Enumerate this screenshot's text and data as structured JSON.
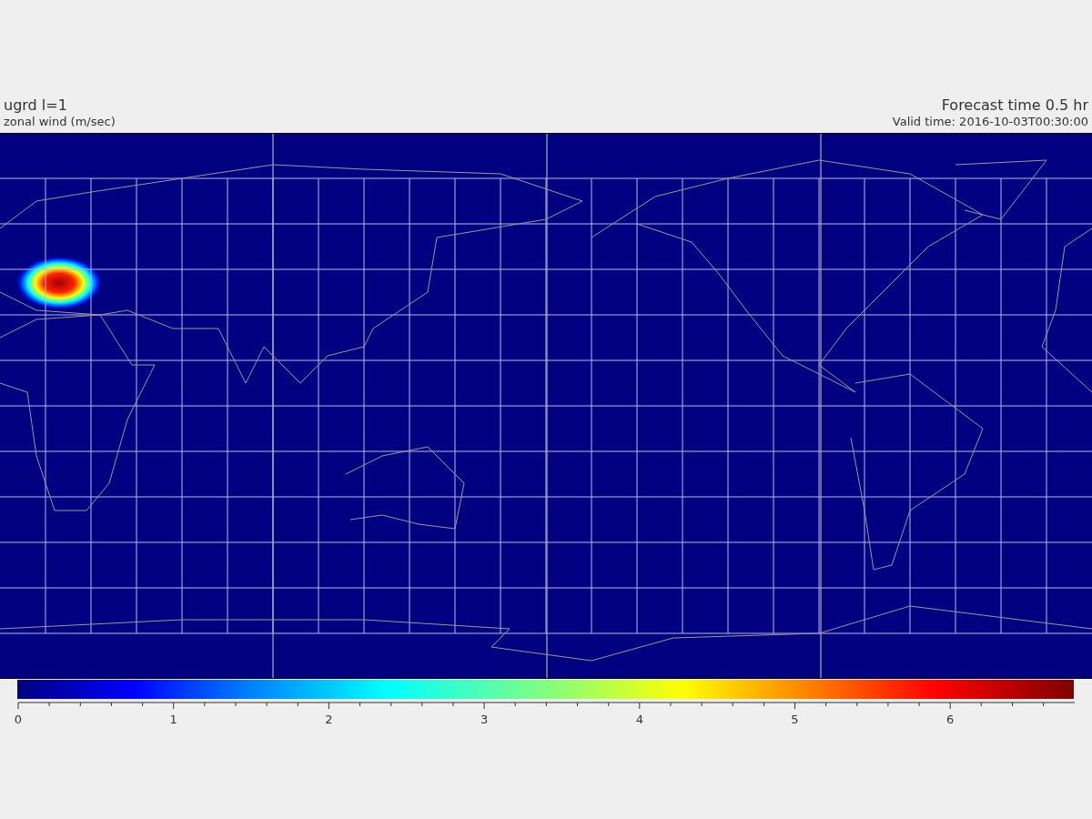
{
  "header": {
    "title": "ugrd l=1",
    "subtitle": "zonal wind (m/sec)",
    "forecast": "Forecast time 0.5 hr",
    "valid_time": "Valid time: 2016-10-03T00:30:00"
  },
  "colorbar": {
    "ticks": [
      "0",
      "1",
      "2",
      "3",
      "4",
      "5",
      "6"
    ]
  }
}
